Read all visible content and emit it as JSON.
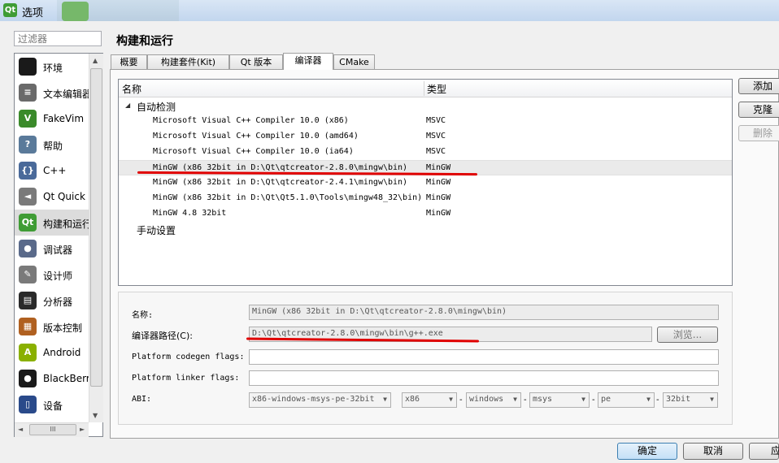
{
  "window": {
    "title": "选项",
    "app_icon": "Qt"
  },
  "filter": {
    "placeholder": "过滤器"
  },
  "sidebar": {
    "items": [
      {
        "label": "环境",
        "icon": "monitor-icon",
        "icon_text": "",
        "color": "#1a1a1a"
      },
      {
        "label": "文本编辑器",
        "icon": "text-editor-icon",
        "icon_text": "≡",
        "color": "#6a6a6a"
      },
      {
        "label": "FakeVim",
        "icon": "fakevim-icon",
        "icon_text": "V",
        "color": "#3a8a2a"
      },
      {
        "label": "帮助",
        "icon": "help-icon",
        "icon_text": "?",
        "color": "#5a7a9a"
      },
      {
        "label": "C++",
        "icon": "cpp-icon",
        "icon_text": "{}",
        "color": "#4a6a9a"
      },
      {
        "label": "Qt Quick",
        "icon": "qtquick-icon",
        "icon_text": "◄",
        "color": "#7a7a7a"
      },
      {
        "label": "构建和运行",
        "icon": "build-run-icon",
        "icon_text": "Qt",
        "color": "#3f9c35",
        "selected": true
      },
      {
        "label": "调试器",
        "icon": "debugger-icon",
        "icon_text": "●",
        "color": "#5a6a8a"
      },
      {
        "label": "设计师",
        "icon": "designer-icon",
        "icon_text": "✎",
        "color": "#7a7a7a"
      },
      {
        "label": "分析器",
        "icon": "analyzer-icon",
        "icon_text": "▤",
        "color": "#2a2a2a"
      },
      {
        "label": "版本控制",
        "icon": "version-control-icon",
        "icon_text": "▦",
        "color": "#b06020"
      },
      {
        "label": "Android",
        "icon": "android-icon",
        "icon_text": "A",
        "color": "#8ab000"
      },
      {
        "label": "BlackBerr",
        "icon": "blackberry-icon",
        "icon_text": "●",
        "color": "#1a1a1a"
      },
      {
        "label": "设备",
        "icon": "device-icon",
        "icon_text": "▯",
        "color": "#2a4a8a"
      }
    ],
    "hscroll_grip": "III"
  },
  "page": {
    "title": "构建和运行"
  },
  "tabs": [
    {
      "label": "概要"
    },
    {
      "label": "构建套件(Kit)"
    },
    {
      "label": "Qt 版本"
    },
    {
      "label": "编译器",
      "active": true
    },
    {
      "label": "CMake"
    }
  ],
  "tree": {
    "columns": [
      "名称",
      "类型"
    ],
    "auto_group": "自动检测",
    "manual_group": "手动设置",
    "rows": [
      {
        "name": "Microsoft Visual C++ Compiler 10.0 (x86)",
        "type": "MSVC"
      },
      {
        "name": "Microsoft Visual C++ Compiler 10.0 (amd64)",
        "type": "MSVC"
      },
      {
        "name": "Microsoft Visual C++ Compiler 10.0 (ia64)",
        "type": "MSVC"
      },
      {
        "name": "MinGW (x86 32bit in D:\\Qt\\qtcreator-2.8.0\\mingw\\bin)",
        "type": "MinGW",
        "selected": true
      },
      {
        "name": "MinGW (x86 32bit in D:\\Qt\\qtcreator-2.4.1\\mingw\\bin)",
        "type": "MinGW"
      },
      {
        "name": "MinGW (x86 32bit in D:\\Qt\\Qt5.1.0\\Tools\\mingw48_32\\bin)",
        "type": "MinGW"
      },
      {
        "name": "MinGW 4.8 32bit",
        "type": "MinGW"
      }
    ]
  },
  "actions": {
    "add": "添加",
    "clone": "克隆",
    "remove": "删除"
  },
  "details": {
    "name_label": "名称:",
    "name_value": "MinGW (x86 32bit in D:\\Qt\\qtcreator-2.8.0\\mingw\\bin)",
    "path_label": "编译器路径(C):",
    "path_value": "D:\\Qt\\qtcreator-2.8.0\\mingw\\bin\\g++.exe",
    "browse": "浏览...",
    "codegen_label": "Platform codegen flags:",
    "codegen_value": "",
    "linker_label": "Platform linker flags:",
    "linker_value": "",
    "abi_label": "ABI:",
    "abi_main": "x86-windows-msys-pe-32bit",
    "abi_parts": [
      "x86",
      "windows",
      "msys",
      "pe",
      "32bit"
    ]
  },
  "footer": {
    "ok": "确定",
    "cancel": "取消",
    "apply": "应"
  },
  "annotation_color": "#e00000"
}
